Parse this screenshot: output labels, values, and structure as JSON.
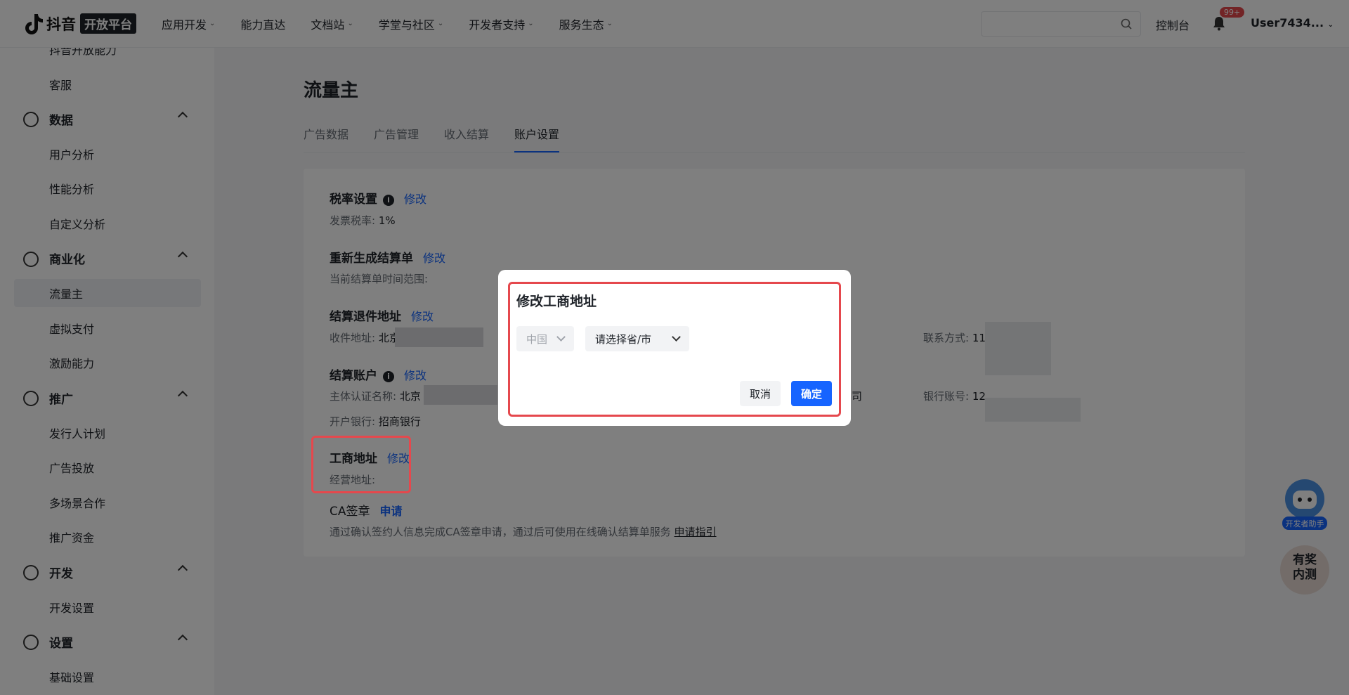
{
  "header": {
    "logo_text": "抖音",
    "logo_badge": "开放平台",
    "nav": [
      {
        "label": "应用开发",
        "has_dropdown": true
      },
      {
        "label": "能力直达",
        "has_dropdown": false
      },
      {
        "label": "文档站",
        "has_dropdown": true
      },
      {
        "label": "学堂与社区",
        "has_dropdown": true
      },
      {
        "label": "开发者支持",
        "has_dropdown": true
      },
      {
        "label": "服务生态",
        "has_dropdown": true
      }
    ],
    "search_placeholder": "",
    "console": "控制台",
    "notification_badge": "99+",
    "user": "User7434..."
  },
  "sidebar": {
    "items": [
      {
        "type": "sub",
        "label": "抖音开放能力"
      },
      {
        "type": "sub",
        "label": "客服"
      },
      {
        "type": "group",
        "label": "数据",
        "icon": "pie-chart-icon"
      },
      {
        "type": "sub",
        "label": "用户分析"
      },
      {
        "type": "sub",
        "label": "性能分析"
      },
      {
        "type": "sub",
        "label": "自定义分析"
      },
      {
        "type": "group",
        "label": "商业化",
        "icon": "yuan-icon"
      },
      {
        "type": "sub",
        "label": "流量主",
        "active": true
      },
      {
        "type": "sub",
        "label": "虚拟支付"
      },
      {
        "type": "sub",
        "label": "激励能力"
      },
      {
        "type": "group",
        "label": "推广",
        "icon": "broadcast-icon"
      },
      {
        "type": "sub",
        "label": "发行人计划"
      },
      {
        "type": "sub",
        "label": "广告投放"
      },
      {
        "type": "sub",
        "label": "多场景合作"
      },
      {
        "type": "sub",
        "label": "推广资金"
      },
      {
        "type": "group",
        "label": "开发",
        "icon": "code-icon"
      },
      {
        "type": "sub",
        "label": "开发设置"
      },
      {
        "type": "group",
        "label": "设置",
        "icon": "settings-icon"
      },
      {
        "type": "sub",
        "label": "基础设置"
      }
    ]
  },
  "main": {
    "title": "流量主",
    "tabs": [
      {
        "label": "广告数据",
        "active": false
      },
      {
        "label": "广告管理",
        "active": false
      },
      {
        "label": "收入结算",
        "active": false
      },
      {
        "label": "账户设置",
        "active": true
      }
    ],
    "sections": {
      "tax": {
        "title": "税率设置",
        "link": "修改",
        "desc_label": "发票税率:",
        "desc_value": "1%"
      },
      "regen": {
        "title": "重新生成结算单",
        "link": "修改",
        "desc_label": "当前结算单时间范围:"
      },
      "return_addr": {
        "title": "结算退件地址",
        "link": "修改",
        "addr_label": "收件地址:",
        "addr_value": "北京",
        "contact_label": "联系方式:",
        "contact_value": "11"
      },
      "account": {
        "title": "结算账户",
        "link": "修改",
        "entity_label": "主体认证名称:",
        "entity_value": "北京",
        "entity_suffix": "司",
        "bank_no_label": "银行账号:",
        "bank_no_value": "12",
        "bank_label": "开户银行:",
        "bank_value": "招商银行"
      },
      "biz_addr": {
        "title": "工商地址",
        "link": "修改",
        "desc_label": "经营地址:"
      },
      "ca": {
        "title": "CA签章",
        "link": "申请",
        "desc": "通过确认签约人信息完成CA签章申请，通过后可使用在线确认结算单服务",
        "desc_link": "申请指引"
      }
    }
  },
  "modal": {
    "title": "修改工商地址",
    "country": "中国",
    "province_placeholder": "请选择省/市",
    "cancel": "取消",
    "confirm": "确定"
  },
  "floating": {
    "assistant_label": "开发者助手",
    "reward_line1": "有奖",
    "reward_line2": "内测"
  },
  "colors": {
    "accent": "#1664ff",
    "highlight": "#e5484d"
  }
}
